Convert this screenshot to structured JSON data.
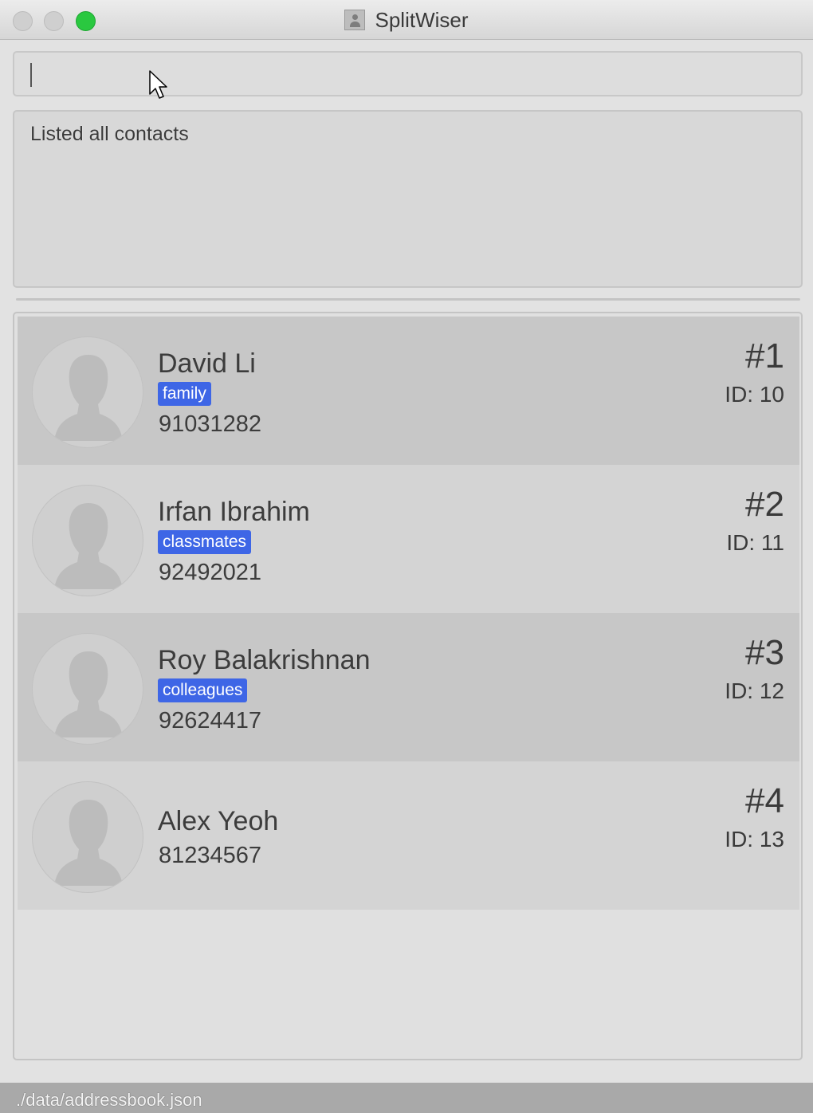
{
  "window": {
    "title": "SplitWiser"
  },
  "command": {
    "value": "",
    "placeholder": ""
  },
  "result": {
    "message": "Listed all contacts"
  },
  "contacts": [
    {
      "name": "David Li",
      "tag": "family",
      "phone": "91031282",
      "index": "#1",
      "id": "ID: 10"
    },
    {
      "name": "Irfan Ibrahim",
      "tag": "classmates",
      "phone": "92492021",
      "index": "#2",
      "id": "ID: 11"
    },
    {
      "name": "Roy Balakrishnan",
      "tag": "colleagues",
      "phone": "92624417",
      "index": "#3",
      "id": "ID: 12"
    },
    {
      "name": "Alex Yeoh",
      "tag": "",
      "phone": "81234567",
      "index": "#4",
      "id": "ID: 13"
    }
  ],
  "status": {
    "path": "./data/addressbook.json"
  },
  "icons": {
    "app": "contacts-app-icon",
    "avatar": "person-silhouette-icon",
    "pointer": "mouse-pointer-icon"
  },
  "colors": {
    "tag": "#3e66e6",
    "card_dark": "#c7c7c7",
    "card_light": "#d4d4d4",
    "traffic_max": "#2ac840"
  }
}
